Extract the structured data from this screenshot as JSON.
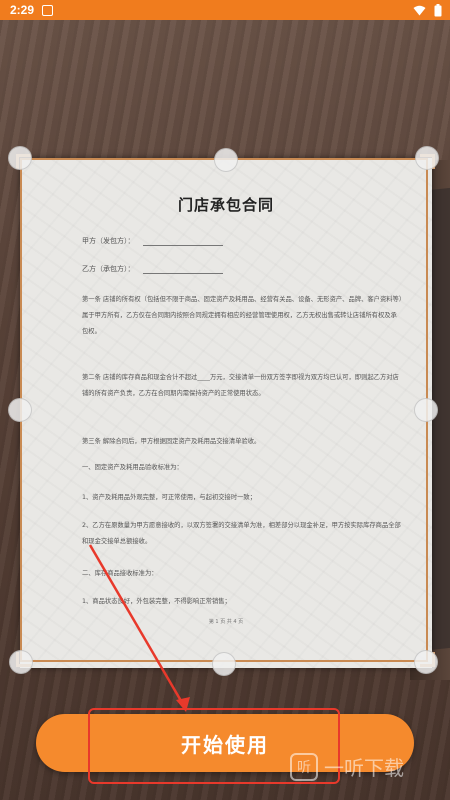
{
  "status_bar": {
    "time": "2:29",
    "icons": [
      "notification-icon",
      "wifi-icon",
      "battery-icon"
    ]
  },
  "document": {
    "title": "门店承包合同",
    "party_a": "甲方（发包方）：",
    "party_b": "乙方（承包方）：",
    "paragraphs": [
      "第一条 店铺的所有权（包括但不限于商品、固定资产及耗用品、经营有关品、设备、无形资产、品牌、客户资料等）属于甲方所有，乙方仅在合同期内按照合同规定拥有相应的经营管理使用权，乙方无权出售或转让店铺所有权及承包权。",
      "第二条 店铺的库存商品和现金合计不超过____万元，交接清单一份双方签字即视为双方均已认可，即则起乙方对店铺的所有资产负责，乙方在合同期内需保持资产的正常使用状态。",
      "第三条 解除合同后，甲方根据固定资产及耗用品交接清单验收。",
      "一、固定资产及耗用品验收标准为：",
      "1、资产及耗用品外观完整，可正常使用，与起初交接时一致；",
      "2、乙方在原数量为甲方愿意接收的，以双方签署的交接清单为准，相差部分以现金补足，甲方按实际库存商品全部和现金交接单总额接收。",
      "二、库存商品接收标准为：",
      "1、商品状态良好，外包装完整，不得影响正常销售；"
    ],
    "footer": "第 1 页 共 4 页"
  },
  "actions": {
    "start_label": "开始使用"
  },
  "watermark": {
    "logo_text": "听",
    "text": "一听下载"
  },
  "colors": {
    "accent": "#f58a2d",
    "status_bar": "#f07c1e",
    "annotation_red": "#e8392b"
  }
}
